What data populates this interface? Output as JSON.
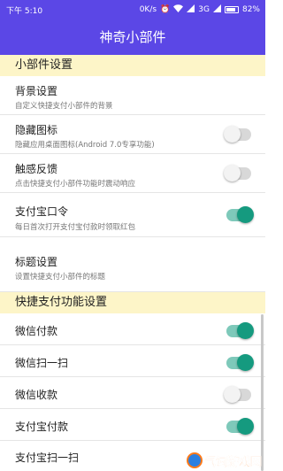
{
  "status_bar": {
    "time": "下午 5:10",
    "speed": "0K/s",
    "network": "3G",
    "battery": "82%"
  },
  "app_bar": {
    "title": "神奇小部件"
  },
  "sections": [
    {
      "title": "小部件设置"
    },
    {
      "title": "快捷支付功能设置"
    }
  ],
  "widget_settings": [
    {
      "title": "背景设置",
      "desc": "自定义快捷支付小部件的背景"
    },
    {
      "title": "隐藏图标",
      "desc": "隐藏应用桌面图标(Android 7.0专享功能)",
      "toggle": false
    },
    {
      "title": "触感反馈",
      "desc": "点击快捷支付小部件功能时震动响应",
      "toggle": false
    },
    {
      "title": "支付宝口令",
      "desc": "每日首次打开支付宝付款时领取红包",
      "toggle": true
    },
    {
      "title": "标题设置",
      "desc": "设置快捷支付小部件的标题"
    }
  ],
  "pay_settings": [
    {
      "title": "微信付款",
      "toggle": true
    },
    {
      "title": "微信扫一扫",
      "toggle": true
    },
    {
      "title": "微信收款",
      "toggle": false
    },
    {
      "title": "支付宝付款",
      "toggle": true
    },
    {
      "title": "支付宝扫一扫"
    }
  ],
  "colors": {
    "primary": "#5b47e6",
    "section_bg": "#fdf5c8",
    "toggle_on": "#159a7f",
    "toggle_off": "#d8d8d8"
  },
  "watermark": {
    "text": "气词游戏网"
  }
}
